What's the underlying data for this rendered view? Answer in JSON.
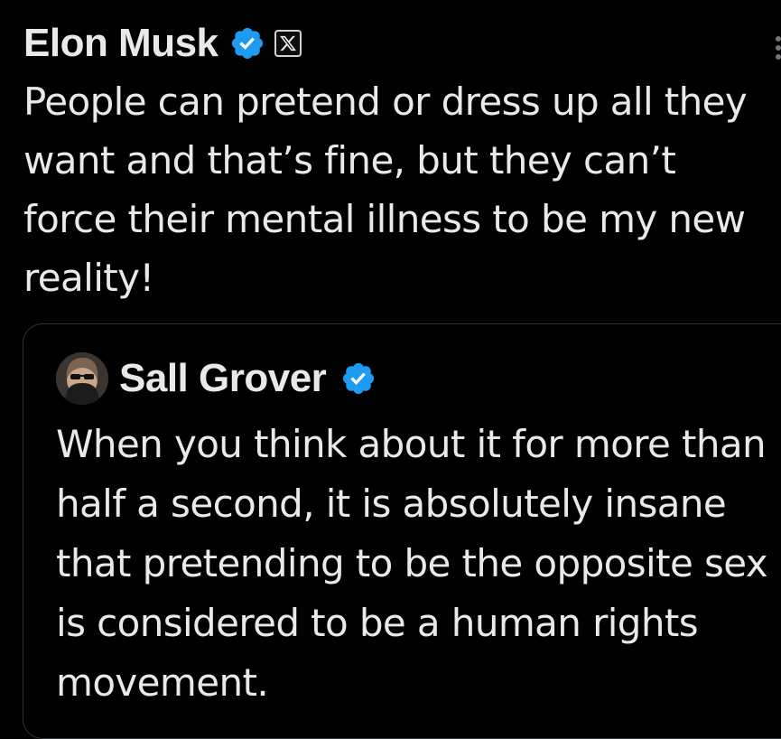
{
  "post": {
    "author_name": "Elon Musk",
    "verified_icon": "verified-badge-icon",
    "affiliate_icon": "x-logo-icon",
    "text": "People can pretend or dress up all they want and that’s fine, but they can’t force their mental illness to be my new reality!"
  },
  "quoted_post": {
    "author_name": "Sall Grover",
    "avatar_icon": "avatar",
    "verified_icon": "verified-badge-icon",
    "text": "When you think about it for more than half a second, it is absolutely insane that pretending to be the opposite sex is considered to be a human rights movement."
  },
  "colors": {
    "background": "#000000",
    "text": "#e7e9ea",
    "verified_blue": "#1d9bf0",
    "border": "#2f3336"
  }
}
